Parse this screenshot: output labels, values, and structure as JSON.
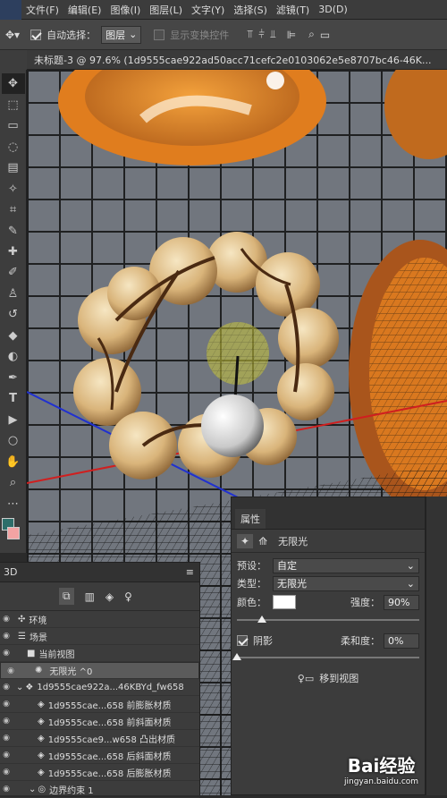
{
  "menubar": {
    "items": [
      "文件(F)",
      "编辑(E)",
      "图像(I)",
      "图层(L)",
      "文字(Y)",
      "选择(S)",
      "滤镜(T)",
      "3D(D)"
    ]
  },
  "options": {
    "auto_select_label": "自动选择：",
    "auto_select_value": "图层",
    "show_transform_label": "显示变换控件"
  },
  "document_tab": {
    "title": "未标题-3 @ 97.6% (1d9555cae922ad50acc71cefc2e0103062e5e8707bc46-46K..."
  },
  "panel3d": {
    "title": "3D",
    "rows": [
      {
        "label": "环境",
        "indent": 1
      },
      {
        "label": "场景",
        "indent": 1
      },
      {
        "label": "当前视图",
        "indent": 2
      },
      {
        "label": "无限光 ^0",
        "indent": 2,
        "selected": true
      },
      {
        "label": "1d9555cae922a...46KBYd_fw658",
        "indent": 2
      },
      {
        "label": "1d9555cae...658 前膨胀材质",
        "indent": 3
      },
      {
        "label": "1d9555cae...658 前斜面材质",
        "indent": 3
      },
      {
        "label": "1d9555cae9...w658 凸出材质",
        "indent": 3
      },
      {
        "label": "1d9555cae...658 后斜面材质",
        "indent": 3
      },
      {
        "label": "1d9555cae...658 后膨胀材质",
        "indent": 3
      },
      {
        "label": "边界约束 1",
        "indent": 3
      }
    ]
  },
  "properties": {
    "title": "属性",
    "light_name": "无限光",
    "preset_label": "预设：",
    "preset_value": "自定",
    "type_label": "类型：",
    "type_value": "无限光",
    "color_label": "颜色：",
    "intensity_label": "强度：",
    "intensity_value": "90%",
    "intensity_level": 0.9,
    "shadow_label": "阴影",
    "softness_label": "柔和度：",
    "softness_value": "0%",
    "softness_level": 0,
    "move_to_view_label": "移到视图"
  },
  "watermark": {
    "brand": "Bai经验",
    "url": "jingyan.baidu.com"
  },
  "colors": {
    "foreground": "#2e6e6a",
    "background": "#f2a3a3",
    "light_color": "#ffffff"
  }
}
